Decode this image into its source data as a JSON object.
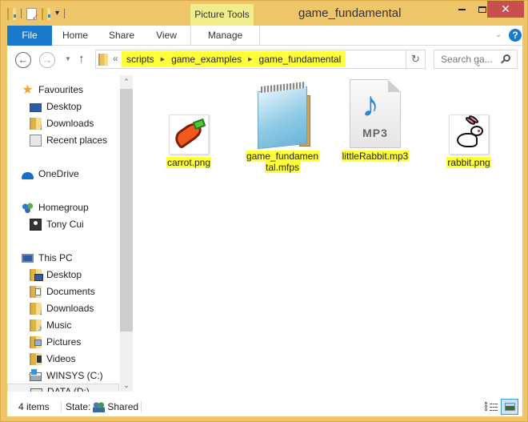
{
  "window": {
    "title": "game_fundamental",
    "contextual_tab_group": "Picture Tools",
    "controls": {
      "minimize": "—",
      "maximize": "□",
      "close": "✕"
    }
  },
  "ribbon": {
    "tabs": [
      {
        "label": "File",
        "active": true
      },
      {
        "label": "Home"
      },
      {
        "label": "Share"
      },
      {
        "label": "View"
      },
      {
        "label": "Manage"
      }
    ],
    "expand_icon": "⌄",
    "help_icon": "?"
  },
  "navigation": {
    "back": "←",
    "forward": "→",
    "recent": "▼",
    "up": "↑",
    "overflow": "«",
    "breadcrumb": [
      "scripts",
      "game_examples",
      "game_fundamental"
    ],
    "breadcrumb_separator": "▶",
    "address_dropdown": "⌄",
    "refresh": "↻",
    "search_placeholder": "Search ga..."
  },
  "sidebar": {
    "items": [
      {
        "label": "Favourites",
        "icon": "star-icon",
        "level": 0
      },
      {
        "label": "Desktop",
        "icon": "desktop-icon",
        "level": 1
      },
      {
        "label": "Downloads",
        "icon": "downloads-folder-icon",
        "level": 1
      },
      {
        "label": "Recent places",
        "icon": "recent-places-icon",
        "level": 1
      },
      {
        "label": "OneDrive",
        "icon": "onedrive-icon",
        "level": 0
      },
      {
        "label": "Homegroup",
        "icon": "homegroup-icon",
        "level": 0
      },
      {
        "label": "Tony Cui",
        "icon": "user-icon",
        "level": 1
      },
      {
        "label": "This PC",
        "icon": "computer-icon",
        "level": 0
      },
      {
        "label": "Desktop",
        "icon": "desktop-folder-icon",
        "level": 1
      },
      {
        "label": "Documents",
        "icon": "documents-folder-icon",
        "level": 1
      },
      {
        "label": "Downloads",
        "icon": "downloads-folder-icon",
        "level": 1
      },
      {
        "label": "Music",
        "icon": "music-folder-icon",
        "level": 1
      },
      {
        "label": "Pictures",
        "icon": "pictures-folder-icon",
        "level": 1
      },
      {
        "label": "Videos",
        "icon": "videos-folder-icon",
        "level": 1
      },
      {
        "label": "WINSYS (C:)",
        "icon": "system-drive-icon",
        "level": 1
      },
      {
        "label": "DATA (D:)",
        "icon": "drive-icon",
        "level": 1,
        "selected": true
      }
    ],
    "scroll_up": "⌃",
    "scroll_down": "⌄"
  },
  "files": [
    {
      "name": "carrot.png",
      "type": "image"
    },
    {
      "name": "game_fundamental.mfps",
      "name_line1": "game_fundamen",
      "name_line2": "tal.mfps",
      "type": "notepad"
    },
    {
      "name": "littleRabbit.mp3",
      "type": "audio",
      "badge": "MP3",
      "glyph": "♪"
    },
    {
      "name": "rabbit.png",
      "type": "image"
    }
  ],
  "status": {
    "item_count": "4 items",
    "state_label": "State:",
    "state_value": "Shared"
  }
}
